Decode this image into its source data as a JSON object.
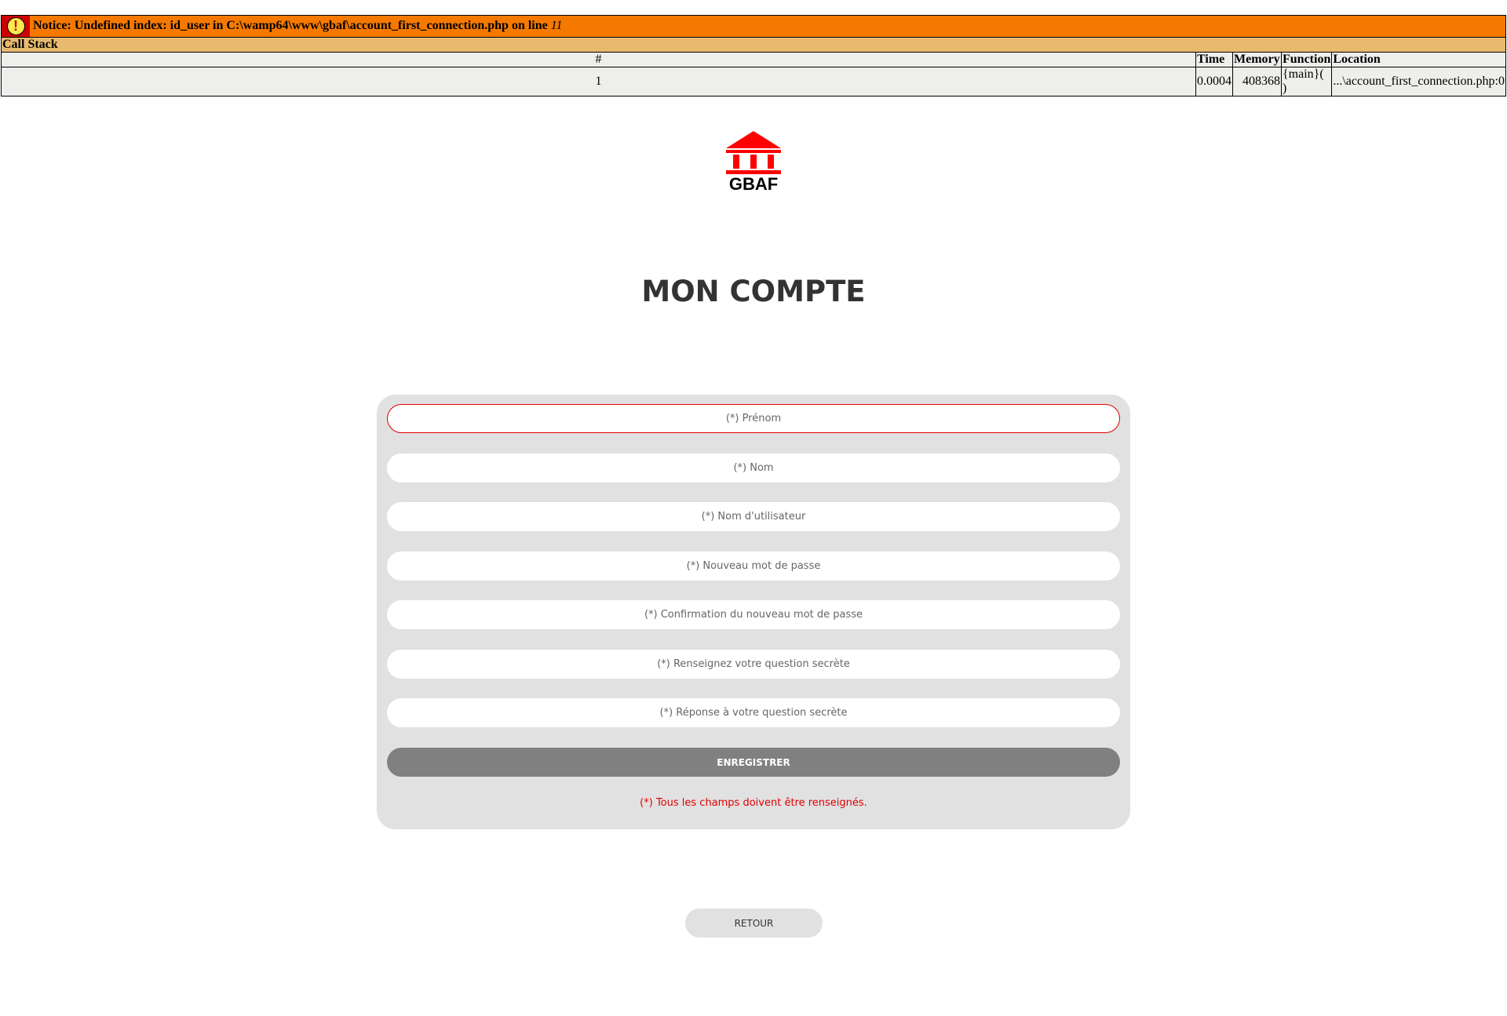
{
  "notice": {
    "icon": "exclamation-icon",
    "prefix": "Notice: Undefined index: id_user in C:\\wamp64\\www\\gbaf\\account_first_connection.php on line ",
    "line": "11",
    "call_stack_label": "Call Stack",
    "headers": [
      "#",
      "Time",
      "Memory",
      "Function",
      "Location"
    ],
    "rows": [
      {
        "num": "1",
        "time": "0.0004",
        "memory": "408368",
        "function": "{main}( )",
        "location": "...\\account_first_connection.php:0"
      }
    ]
  },
  "logo": {
    "icon": "bank-building-icon",
    "text": "GBAF",
    "color": "#ff0000"
  },
  "title": "MON COMPTE",
  "form": {
    "fields": [
      {
        "placeholder": "(*) Prénom",
        "type": "text"
      },
      {
        "placeholder": "(*) Nom",
        "type": "text"
      },
      {
        "placeholder": "(*) Nom d'utilisateur",
        "type": "text"
      },
      {
        "placeholder": "(*) Nouveau mot de passe",
        "type": "password"
      },
      {
        "placeholder": "(*) Confirmation du nouveau mot de passe",
        "type": "password"
      },
      {
        "placeholder": "(*) Renseignez votre question secrète",
        "type": "text"
      },
      {
        "placeholder": "(*) Réponse à votre question secrète",
        "type": "text"
      }
    ],
    "submit_label": "ENREGISTRER",
    "required_note": "(*) Tous les champs doivent être renseignés."
  },
  "back_label": "RETOUR",
  "colors": {
    "accent_red": "#e00000",
    "panel_bg": "#e1e1e1",
    "submit_bg": "#808080",
    "notice_orange": "#f57900",
    "callstack_tan": "#e9b96e"
  }
}
